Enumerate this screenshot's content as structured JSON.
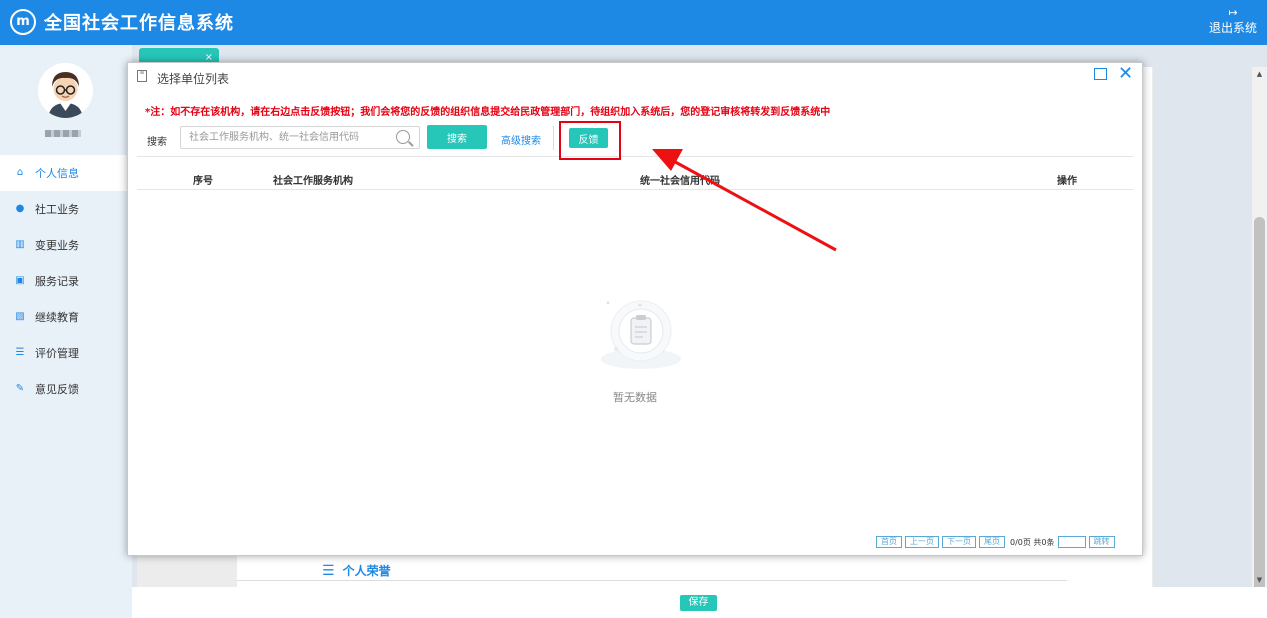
{
  "header": {
    "title": "全国社会工作信息系统",
    "logout_label": "退出系统"
  },
  "sidebar": {
    "items": [
      {
        "label": "个人信息",
        "icon": "home-icon"
      },
      {
        "label": "社工业务",
        "icon": "user-icon"
      },
      {
        "label": "变更业务",
        "icon": "building-icon"
      },
      {
        "label": "服务记录",
        "icon": "chart-icon"
      },
      {
        "label": "继续教育",
        "icon": "education-icon"
      },
      {
        "label": "评价管理",
        "icon": "list-icon"
      },
      {
        "label": "意见反馈",
        "icon": "edit-icon"
      }
    ]
  },
  "modal": {
    "title": "选择单位列表",
    "notice": "*注：如不存在该机构，请在右边点击反馈按钮；我们会将您的反馈的组织信息提交给民政管理部门，待组织加入系统后，您的登记审核将转发到反馈系统中",
    "search_label": "搜索",
    "search_placeholder": "社会工作服务机构、统一社会信用代码",
    "search_button": "搜索",
    "advanced_search": "高级搜索",
    "feedback_button": "反馈",
    "columns": [
      "序号",
      "社会工作服务机构",
      "统一社会信用代码",
      "操作"
    ],
    "empty_text": "暂无数据",
    "pager": {
      "first": "首页",
      "prev": "上一页",
      "next": "下一页",
      "last": "尾页",
      "info": "0/0页 共0条",
      "jump": "跳转"
    }
  },
  "form": {
    "section_title": "个人荣誉",
    "save_label": "保存"
  },
  "colors": {
    "primary": "#1e88e5",
    "accent": "#26c6b9",
    "alert": "#e60012"
  }
}
